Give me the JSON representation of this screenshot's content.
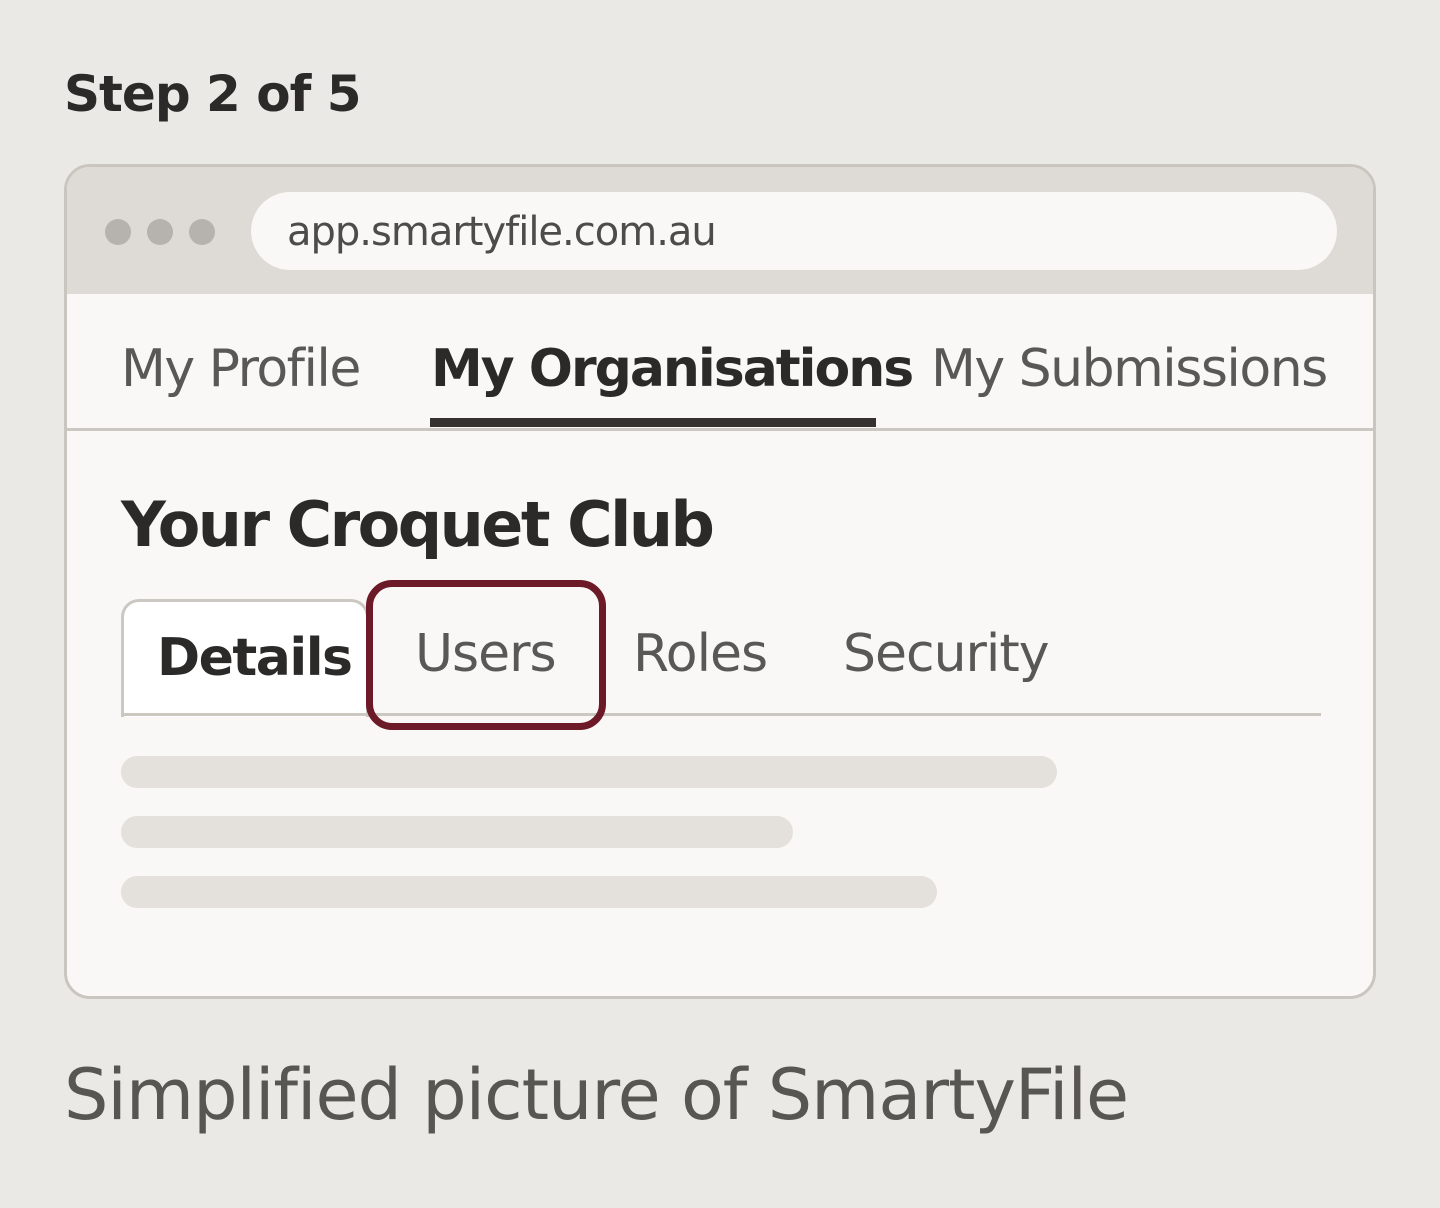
{
  "step_label": "Step 2 of 5",
  "browser": {
    "url": "app.smartyfile.com.au",
    "window_dot_icons": [
      "window-dot-icon",
      "window-dot-icon",
      "window-dot-icon"
    ]
  },
  "top_nav": {
    "items": [
      {
        "label": "My Profile",
        "active": false
      },
      {
        "label": "My Organisations",
        "active": true
      },
      {
        "label": "My Submissions",
        "active": false
      }
    ]
  },
  "organisation": {
    "title": "Your Croquet Club",
    "tabs": [
      {
        "label": "Details",
        "active": true,
        "highlighted": false
      },
      {
        "label": "Users",
        "active": false,
        "highlighted": true
      },
      {
        "label": "Roles",
        "active": false,
        "highlighted": false
      },
      {
        "label": "Security",
        "active": false,
        "highlighted": false
      }
    ]
  },
  "caption": "Simplified picture of SmartyFile",
  "colors": {
    "page_background": "#ebe9e5",
    "highlight": "#6c1a27",
    "active_underline": "#34312f"
  }
}
